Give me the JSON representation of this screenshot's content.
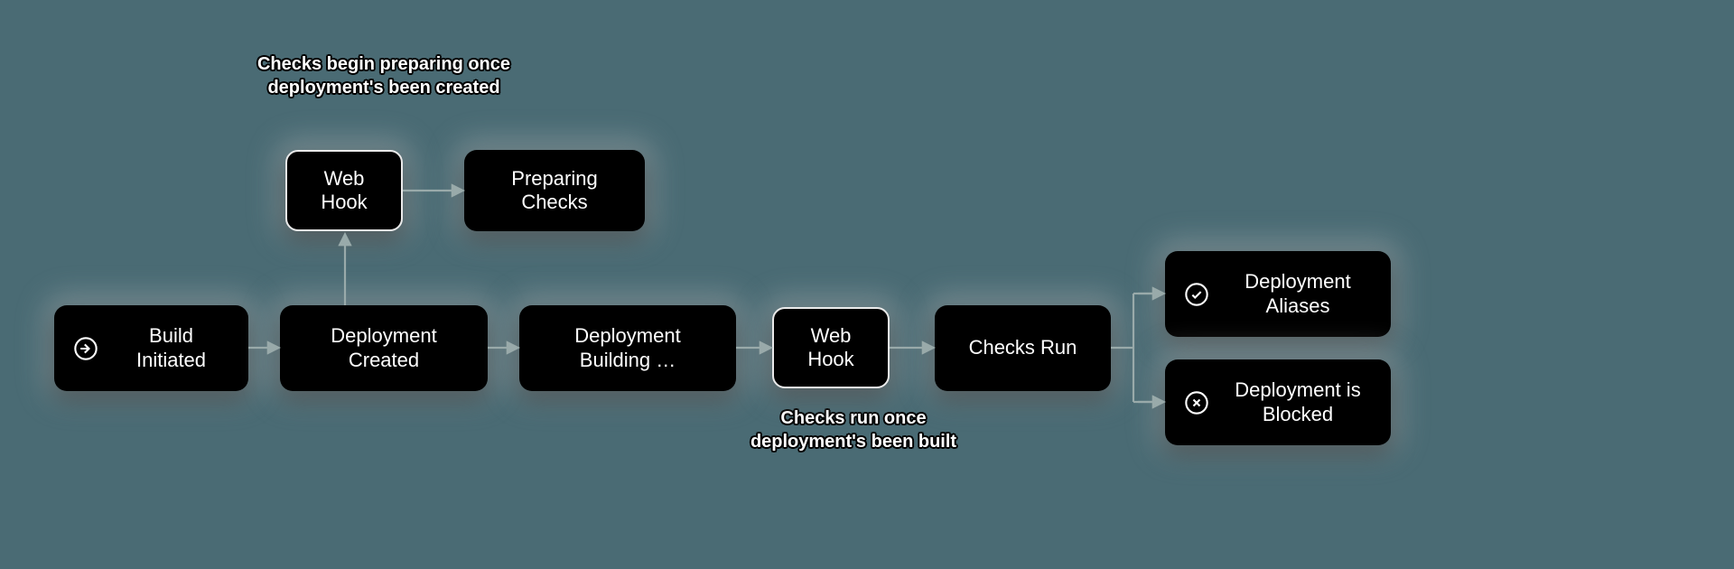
{
  "annotations": {
    "topLeft": "Checks begin preparing once deployment's been created",
    "bottomMid": "Checks run once deployment's been built"
  },
  "nodes": {
    "buildInitiated": "Build Initiated",
    "deploymentCreated": "Deployment Created",
    "deploymentBuilding": "Deployment Building …",
    "webHookTop": "Web Hook",
    "preparingChecks": "Preparing Checks",
    "webHookMid": "Web Hook",
    "checksRun": "Checks Run",
    "deploymentAliases": "Deployment Aliases",
    "deploymentBlocked": "Deployment is Blocked"
  },
  "icons": {
    "buildInitiated": "arrow-right-circle",
    "aliases": "check-circle",
    "blocked": "x-circle"
  }
}
